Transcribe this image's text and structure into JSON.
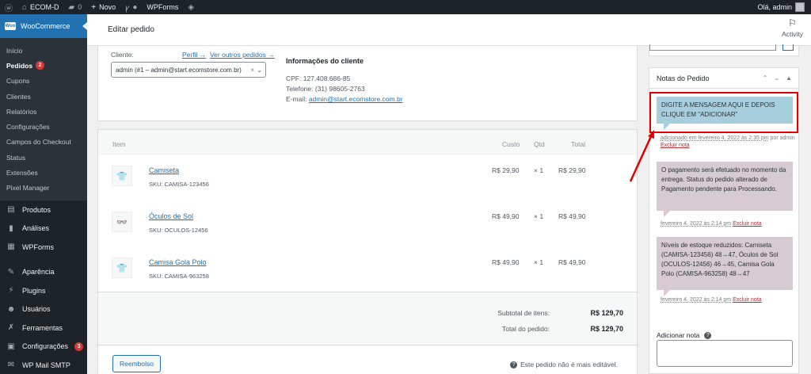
{
  "adminbar": {
    "site_name": "ECOM-D",
    "comments_count": "0",
    "new_label": "Novo",
    "wpforms_label": "WPForms",
    "greeting": "Olá, admin"
  },
  "sidebar": {
    "woocommerce_label": "WooCommerce",
    "submenu": [
      {
        "label": "Início"
      },
      {
        "label": "Pedidos",
        "badge": "2"
      },
      {
        "label": "Cupons"
      },
      {
        "label": "Clientes"
      },
      {
        "label": "Relatórios"
      },
      {
        "label": "Configurações"
      },
      {
        "label": "Campos do Checkout"
      },
      {
        "label": "Status"
      },
      {
        "label": "Extensões"
      },
      {
        "label": "Pixel Manager"
      }
    ],
    "menu": [
      {
        "label": "Produtos",
        "icon": "archive-icon"
      },
      {
        "label": "Análises",
        "icon": "chart-icon"
      },
      {
        "label": "WPForms",
        "icon": "form-icon"
      },
      {
        "label": "Aparência",
        "icon": "brush-icon"
      },
      {
        "label": "Plugins",
        "icon": "plug-icon"
      },
      {
        "label": "Usuários",
        "icon": "user-icon"
      },
      {
        "label": "Ferramentas",
        "icon": "wrench-icon"
      },
      {
        "label": "Configurações",
        "icon": "settings-icon",
        "badge": "3"
      },
      {
        "label": "WP Mail SMTP",
        "icon": "mail-icon"
      }
    ]
  },
  "header": {
    "title": "Editar pedido",
    "activity_label": "Activity"
  },
  "customer": {
    "label": "Cliente:",
    "profile_link": "Perfil →",
    "other_orders_link": "Ver outros pedidos →",
    "selected": "admin (#1 – admin@start.ecomstore.com.br)",
    "info_title": "Informações do cliente",
    "cpf": "CPF: 127.408.686-85",
    "phone": "Telefone: (31) 98605-2763",
    "email_label": "E-mail:",
    "email": "admin@start.ecomstore.com.br"
  },
  "items": {
    "headers": {
      "item": "Item",
      "cost": "Custo",
      "qty": "Qtd",
      "total": "Total"
    },
    "rows": [
      {
        "name": "Camiseta",
        "sku": "SKU: CAMISA-123456",
        "cost": "R$ 29,90",
        "qty": "× 1",
        "total": "R$ 29,90",
        "icon": "tshirt-icon"
      },
      {
        "name": "Óculos de Sol",
        "sku": "SKU: OCULOS-12456",
        "cost": "R$ 49,90",
        "qty": "× 1",
        "total": "R$ 49,90",
        "icon": "glasses-icon"
      },
      {
        "name": "Camisa Gola Polo",
        "sku": "SKU: CAMISA-963258",
        "cost": "R$ 49,90",
        "qty": "× 1",
        "total": "R$ 49,90",
        "icon": "polo-icon"
      }
    ],
    "subtotal_label": "Subtotal de itens:",
    "subtotal_value": "R$ 129,70",
    "total_label": "Total do pedido:",
    "total_value": "R$ 129,70",
    "refund_button": "Reembolso",
    "not_editable": "Este pedido não é mais editável."
  },
  "notes": {
    "title": "Notas do Pedido",
    "list": [
      {
        "text": "DIGITE A MENSAGEM AQUI E DEPOIS CLIQUE EM \"ADICIONAR\"",
        "meta_date": "adicionado em fevereiro 4, 2022 às 2:35 pm",
        "meta_by": "por admin",
        "delete": "Excluir nota"
      },
      {
        "text": "O pagamento será efetuado no momento da entrega. Status do pedido alterado de Pagamento pendente para Processando.",
        "meta_date": "fevereiro 4, 2022 às 2:14 pm",
        "delete": "Excluir nota"
      },
      {
        "text": "Níveis de estoque reduzidos: Camiseta (CAMISA-123456) 48→47, Óculos de Sol (OCULOS-12456) 46→45, Camisa Gola Polo (CAMISA-963258) 48→47",
        "meta_date": "fevereiro 4, 2022 às 2:14 pm",
        "delete": "Excluir nota"
      }
    ],
    "add_label": "Adicionar nota",
    "help_icon": "?"
  },
  "colors": {
    "admin_dark": "#1d2327",
    "accent": "#2271b1",
    "customer_note": "#a7cedc",
    "system_note": "#d7cad2",
    "annotation": "#e00000"
  }
}
